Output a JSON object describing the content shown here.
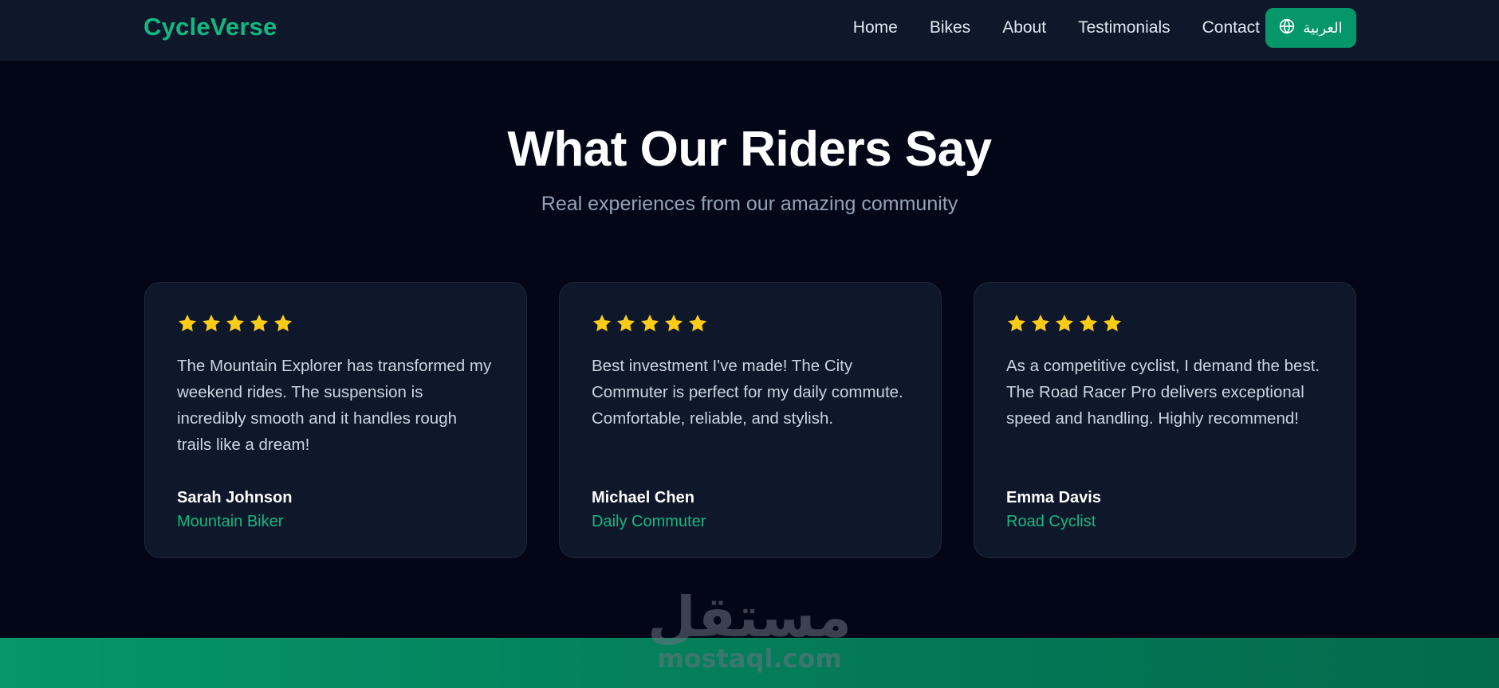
{
  "header": {
    "logo": "CycleVerse",
    "nav": [
      "Home",
      "Bikes",
      "About",
      "Testimonials",
      "Contact"
    ],
    "language_button": "العربية",
    "language_icon": "globe-icon"
  },
  "section": {
    "title": "What Our Riders Say",
    "subtitle": "Real experiences from our amazing community"
  },
  "testimonials": [
    {
      "rating": 5,
      "quote": "The Mountain Explorer has transformed my weekend rides. The suspension is incredibly smooth and it handles rough trails like a dream!",
      "name": "Sarah Johnson",
      "role": "Mountain Biker"
    },
    {
      "rating": 5,
      "quote": "Best investment I've made! The City Commuter is perfect for my daily commute. Comfortable, reliable, and stylish.",
      "name": "Michael Chen",
      "role": "Daily Commuter"
    },
    {
      "rating": 5,
      "quote": "As a competitive cyclist, I demand the best. The Road Racer Pro delivers exceptional speed and handling. Highly recommend!",
      "name": "Emma Davis",
      "role": "Road Cyclist"
    }
  ],
  "watermark": {
    "arabic": "مستقل",
    "latin": "mostaql.com"
  },
  "colors": {
    "background": "#020617",
    "surface": "#0f172a",
    "accent": "#10b981",
    "accent_button": "#059669",
    "star": "#facc15"
  }
}
